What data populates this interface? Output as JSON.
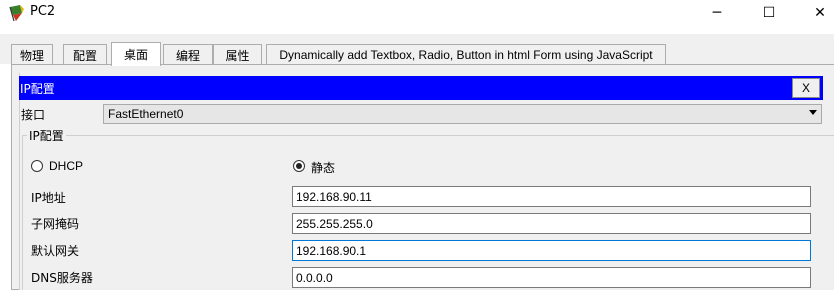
{
  "window": {
    "title": "PC2",
    "icon": "packet-tracer-pc-icon",
    "minimize_glyph": "─",
    "maximize_glyph": "☐",
    "close_glyph": "✕"
  },
  "tabs": [
    {
      "label": "物理"
    },
    {
      "label": "配置"
    },
    {
      "label": "桌面",
      "active": true
    },
    {
      "label": "编程"
    },
    {
      "label": "属性"
    },
    {
      "label": "Dynamically add Textbox, Radio, Button in html Form using JavaScript"
    }
  ],
  "ip_config": {
    "header": "IP配置",
    "close_label": "X",
    "interface_label": "接口",
    "interface_value": "FastEthernet0",
    "group_title": "IP配置",
    "dhcp_label": "DHCP",
    "static_label": "静态",
    "mode": "static",
    "fields": {
      "ip_label": "IP地址",
      "ip_value": "192.168.90.11",
      "mask_label": "子网掩码",
      "mask_value": "255.255.255.0",
      "gateway_label": "默认网关",
      "gateway_value": "192.168.90.1",
      "dns_label": "DNS服务器",
      "dns_value": "0.0.0.0"
    }
  },
  "colors": {
    "header_bg": "#0000ff",
    "focus_border": "#0078d7"
  }
}
